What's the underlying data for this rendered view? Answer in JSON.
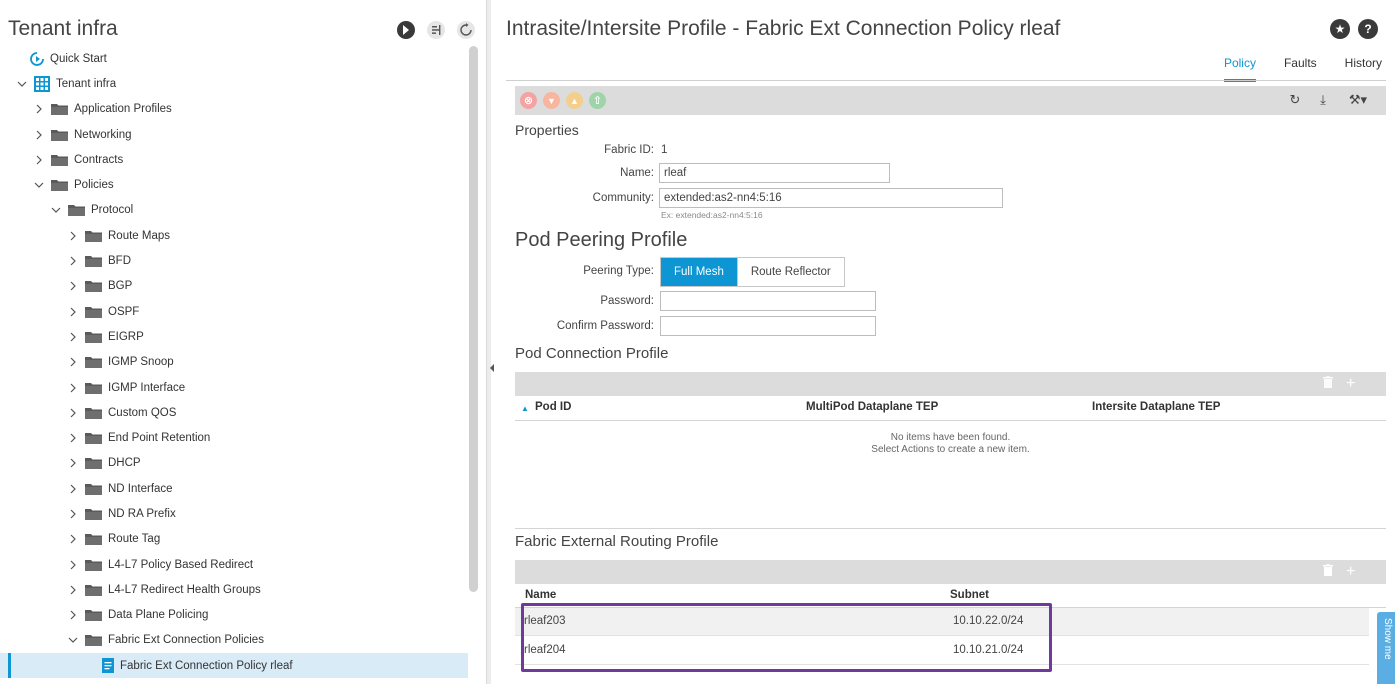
{
  "nav": {
    "title": "Tenant infra",
    "tools": [
      {
        "icon": "quickstart-drop-icon"
      },
      {
        "icon": "filter-icon"
      },
      {
        "icon": "refresh-icon"
      }
    ],
    "tree": [
      {
        "label": "Quick Start",
        "level": 0,
        "chevron": "none",
        "icon": "quickstart-arrow-icon"
      },
      {
        "label": "Tenant infra",
        "level": 0,
        "chevron": "down",
        "icon": "tenant-grid-icon"
      },
      {
        "label": "Application Profiles",
        "level": 1,
        "chevron": "right",
        "icon": "folder-icon"
      },
      {
        "label": "Networking",
        "level": 1,
        "chevron": "right",
        "icon": "folder-icon"
      },
      {
        "label": "Contracts",
        "level": 1,
        "chevron": "right",
        "icon": "folder-icon"
      },
      {
        "label": "Policies",
        "level": 1,
        "chevron": "down",
        "icon": "folder-icon"
      },
      {
        "label": "Protocol",
        "level": 2,
        "chevron": "down",
        "icon": "folder-icon"
      },
      {
        "label": "Route Maps",
        "level": 3,
        "chevron": "right",
        "icon": "folder-icon"
      },
      {
        "label": "BFD",
        "level": 3,
        "chevron": "right",
        "icon": "folder-icon"
      },
      {
        "label": "BGP",
        "level": 3,
        "chevron": "right",
        "icon": "folder-icon"
      },
      {
        "label": "OSPF",
        "level": 3,
        "chevron": "right",
        "icon": "folder-icon"
      },
      {
        "label": "EIGRP",
        "level": 3,
        "chevron": "right",
        "icon": "folder-icon"
      },
      {
        "label": "IGMP Snoop",
        "level": 3,
        "chevron": "right",
        "icon": "folder-icon"
      },
      {
        "label": "IGMP Interface",
        "level": 3,
        "chevron": "right",
        "icon": "folder-icon"
      },
      {
        "label": "Custom QOS",
        "level": 3,
        "chevron": "right",
        "icon": "folder-icon"
      },
      {
        "label": "End Point Retention",
        "level": 3,
        "chevron": "right",
        "icon": "folder-icon"
      },
      {
        "label": "DHCP",
        "level": 3,
        "chevron": "right",
        "icon": "folder-icon"
      },
      {
        "label": "ND Interface",
        "level": 3,
        "chevron": "right",
        "icon": "folder-icon"
      },
      {
        "label": "ND RA Prefix",
        "level": 3,
        "chevron": "right",
        "icon": "folder-icon"
      },
      {
        "label": "Route Tag",
        "level": 3,
        "chevron": "right",
        "icon": "folder-icon"
      },
      {
        "label": "L4-L7 Policy Based Redirect",
        "level": 3,
        "chevron": "right",
        "icon": "folder-icon"
      },
      {
        "label": "L4-L7 Redirect Health Groups",
        "level": 3,
        "chevron": "right",
        "icon": "folder-icon"
      },
      {
        "label": "Data Plane Policing",
        "level": 3,
        "chevron": "right",
        "icon": "folder-icon"
      },
      {
        "label": "Fabric Ext Connection Policies",
        "level": 3,
        "chevron": "down",
        "icon": "folder-icon"
      },
      {
        "label": "Fabric Ext Connection Policy rleaf",
        "level": 4,
        "chevron": "none",
        "icon": "policy-doc-icon",
        "selected": true
      }
    ]
  },
  "main": {
    "title": "Intrasite/Intersite Profile - Fabric Ext Connection Policy rleaf",
    "header_buttons": [
      {
        "icon": "star-icon",
        "glyph": "★"
      },
      {
        "icon": "help-icon",
        "glyph": "?"
      }
    ],
    "tabs": [
      {
        "label": "Policy",
        "active": true
      },
      {
        "label": "Faults",
        "active": false
      },
      {
        "label": "History",
        "active": false
      }
    ],
    "fault_counts": [
      {
        "icon": "critical-fault-icon",
        "glyph": "⊗",
        "color": "#f4a3a3"
      },
      {
        "icon": "major-fault-icon",
        "glyph": "▼",
        "color": "#f6b6a0"
      },
      {
        "icon": "minor-fault-icon",
        "glyph": "▲",
        "color": "#f4cf8c"
      },
      {
        "icon": "warning-fault-icon",
        "glyph": "⇧",
        "color": "#9fd3a8"
      }
    ],
    "bar_tools": [
      {
        "icon": "refresh-icon",
        "glyph": "↻"
      },
      {
        "icon": "download-icon",
        "glyph": "⤓"
      },
      {
        "icon": "tools-icon",
        "glyph": "⚒▾"
      }
    ],
    "properties": {
      "heading": "Properties",
      "fabric_id_label": "Fabric ID:",
      "fabric_id_value": "1",
      "name_label": "Name:",
      "name_value": "rleaf",
      "community_label": "Community:",
      "community_value": "extended:as2-nn4:5:16",
      "community_hint": "Ex: extended:as2-nn4:5:16"
    },
    "pod_peering": {
      "heading": "Pod Peering Profile",
      "peering_type_label": "Peering Type:",
      "options": [
        {
          "label": "Full Mesh",
          "active": true
        },
        {
          "label": "Route Reflector",
          "active": false
        }
      ],
      "password_label": "Password:",
      "password_value": "",
      "confirm_label": "Confirm Password:",
      "confirm_value": ""
    },
    "pod_connection": {
      "heading": "Pod Connection Profile",
      "columns": [
        "Pod ID",
        "MultiPod Dataplane TEP",
        "Intersite Dataplane TEP"
      ],
      "sort_glyph": "▲",
      "empty_line1": "No items have been found.",
      "empty_line2": "Select Actions to create a new item.",
      "toolbar": [
        {
          "icon": "trash-icon",
          "glyph": "🗑"
        },
        {
          "icon": "add-icon",
          "glyph": "+"
        }
      ]
    },
    "fabric_routing": {
      "heading": "Fabric External Routing Profile",
      "columns": [
        "Name",
        "Subnet"
      ],
      "rows": [
        {
          "name": "rleaf203",
          "subnet": "10.10.22.0/24"
        },
        {
          "name": "rleaf204",
          "subnet": "10.10.21.0/24"
        }
      ],
      "toolbar": [
        {
          "icon": "trash-icon",
          "glyph": "🗑"
        },
        {
          "icon": "add-icon",
          "glyph": "+"
        }
      ]
    },
    "show_me": "Show me"
  },
  "colors": {
    "accent": "#0d95d4",
    "highlight": "#6e3a9b"
  }
}
